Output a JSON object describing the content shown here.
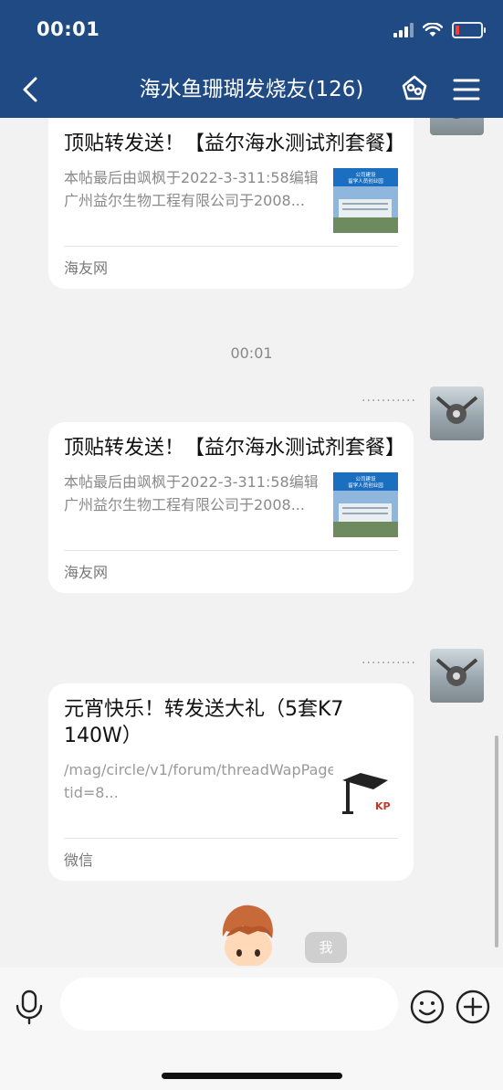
{
  "status_bar": {
    "time": "00:01"
  },
  "header": {
    "title": "海水鱼珊瑚发烧友(126)"
  },
  "messages": [
    {
      "title": "顶贴转发送！【益尔海水测试剂套餐】",
      "desc": "本帖最后由飒枫于2022-3-311:58编辑广州益尔生物工程有限公司于2008...",
      "source": "海友网",
      "thumb_text": "公司建设 留学人员创业园"
    },
    {
      "title": "顶贴转发送！【益尔海水测试剂套餐】",
      "desc": "本帖最后由飒枫于2022-3-311:58编辑广州益尔生物工程有限公司于2008...",
      "source": "海友网",
      "thumb_text": "公司建设 留学人员创业园"
    },
    {
      "title": "元宵快乐！转发送大礼（5套K7 140W）",
      "desc": "/mag/circle/v1/forum/threadWapPage?tid=8...",
      "source": "微信",
      "thumb_text": "KP"
    }
  ],
  "timestamp": "00:01",
  "sender_name": "...........",
  "me_label": "我",
  "colors": {
    "header": "#1f4a84",
    "background": "#f2f2f2",
    "card": "#ffffff"
  }
}
